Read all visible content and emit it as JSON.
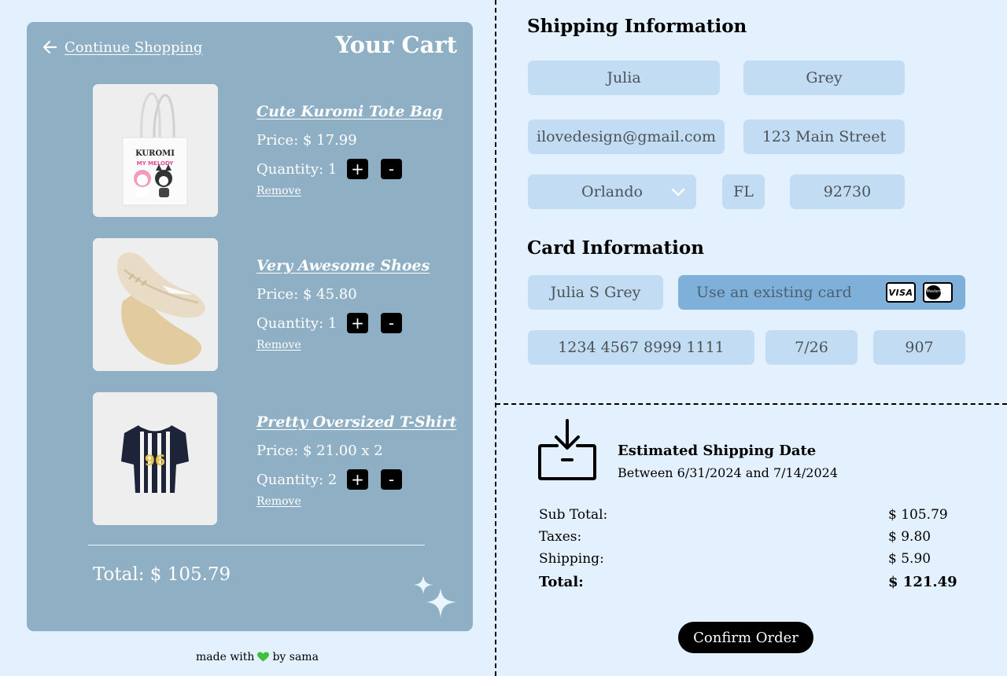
{
  "cart": {
    "continue_label": "Continue Shopping",
    "title": "Your Cart",
    "items": [
      {
        "name": "Cute Kuromi Tote Bag",
        "price": "Price: $ 17.99",
        "quantity": "Quantity: 1",
        "image_text_1": "KUROMI",
        "image_text_2": "MY MELODY"
      },
      {
        "name": "Very Awesome Shoes",
        "price": "Price: $ 45.80",
        "quantity": "Quantity: 1"
      },
      {
        "name": "Pretty Oversized T-Shirt",
        "price": "Price: $ 21.00 x 2",
        "quantity": "Quantity: 2",
        "image_text_1": "96"
      }
    ],
    "plus_label": "+",
    "minus_label": "-",
    "remove_label": "Remove",
    "total": "Total: $ 105.79"
  },
  "footer": {
    "made_with": "made with",
    "by": "by sama",
    "heart_color": "#3ec13e"
  },
  "shipping": {
    "title": "Shipping Information",
    "first_name": "Julia",
    "last_name": "Grey",
    "email": "ilovedesign@gmail.com",
    "address": "123 Main Street",
    "city": "Orlando",
    "state": "FL",
    "zip": "92730"
  },
  "card": {
    "title": "Card Information",
    "cardholder": "Julia S Grey",
    "existing_placeholder": "Use an existing card",
    "number": "1234 4567 8999 1111",
    "expiry": "7/26",
    "cvv": "907",
    "visa_label": "VISA",
    "mastercard_label": "MasterCard"
  },
  "estimate": {
    "title": "Estimated Shipping Date",
    "dates": "Between 6/31/2024 and 7/14/2024"
  },
  "summary": {
    "rows": [
      {
        "label": "Sub Total:",
        "value": "$ 105.79"
      },
      {
        "label": "Taxes:",
        "value": "$ 9.80"
      },
      {
        "label": "Shipping:",
        "value": "$ 5.90"
      },
      {
        "label": "Total:",
        "value": "$ 121.49"
      }
    ],
    "confirm_label": "Confirm Order"
  },
  "colors": {
    "background": "#e3f0fd",
    "cart_panel": "#8eafc4",
    "field": "#c1dcf3",
    "field_active": "#7fb0d9",
    "button": "#000000"
  }
}
